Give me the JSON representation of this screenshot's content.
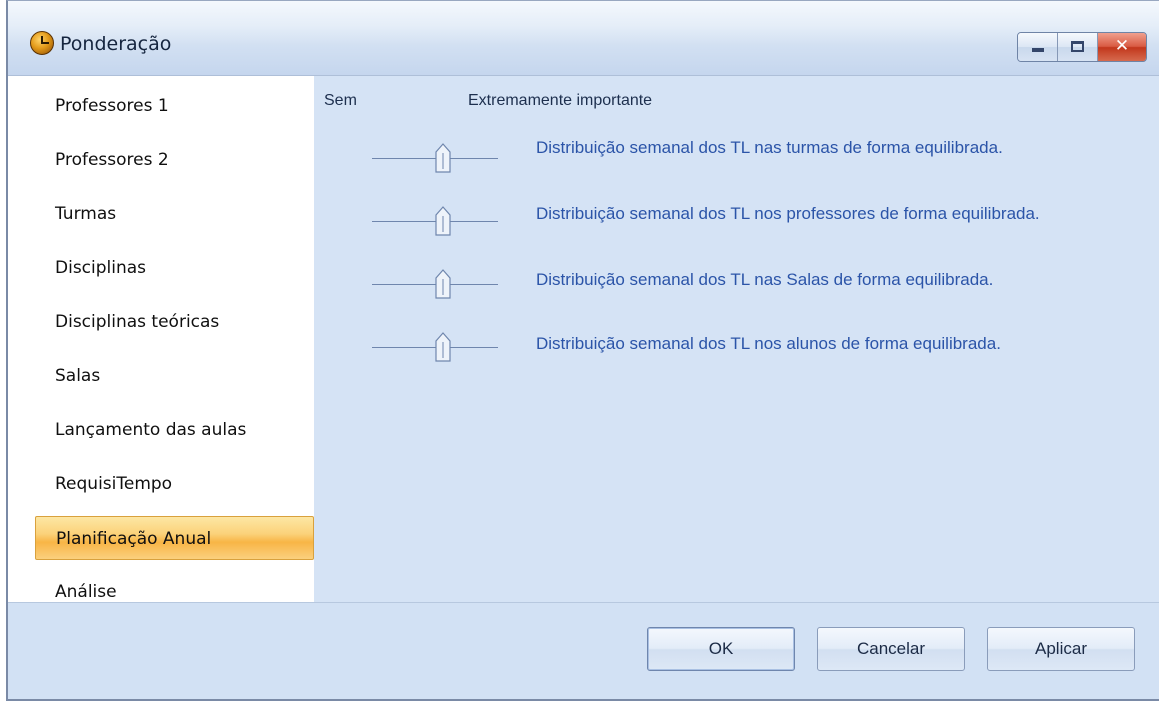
{
  "window": {
    "title": "Ponderação",
    "controls": {
      "minimize": "minimize",
      "maximize": "maximize",
      "close_label": "✕"
    }
  },
  "sidebar": {
    "items": [
      {
        "label": "Professores 1"
      },
      {
        "label": "Professores 2"
      },
      {
        "label": "Turmas"
      },
      {
        "label": "Disciplinas"
      },
      {
        "label": "Disciplinas teóricas"
      },
      {
        "label": "Salas"
      },
      {
        "label": "Lançamento das aulas"
      },
      {
        "label": "RequisiTempo"
      },
      {
        "label": "Planificação Anual",
        "selected": true
      },
      {
        "label": "Análise"
      }
    ]
  },
  "content": {
    "header_min": "Sem",
    "header_max": "Extremamente importante",
    "rows": [
      {
        "label": "Distribuição semanal dos TL nas turmas de forma equilibrada.",
        "level": 0.5
      },
      {
        "label": "Distribuição semanal dos TL nos professores de forma equilibrada.",
        "level": 0.5
      },
      {
        "label": "Distribuição semanal dos TL nas Salas de forma equilibrada.",
        "level": 0.5
      },
      {
        "label": "Distribuição semanal dos TL nos alunos de forma equilibrada.",
        "level": 0.5
      }
    ]
  },
  "footer": {
    "ok_label": "OK",
    "cancel_label": "Cancelar",
    "apply_label": "Aplicar"
  },
  "colors": {
    "content_bg": "#d5e3f5",
    "row_text": "#2b54a8",
    "selected_item": "#f8b546"
  },
  "icons": [
    "app-clock-icon",
    "minimize-icon",
    "maximize-icon",
    "close-icon",
    "slider-thumb-icon"
  ]
}
